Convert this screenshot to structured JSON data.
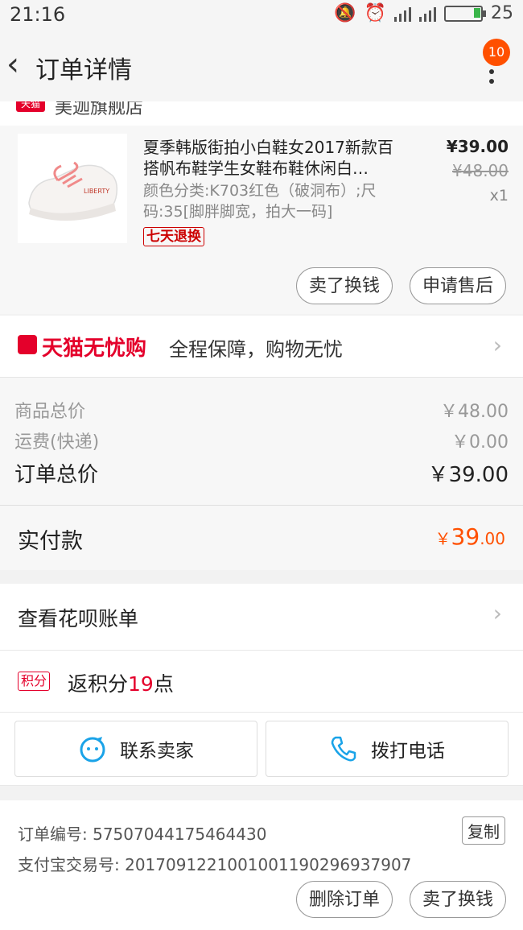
{
  "status": {
    "time": "21:16",
    "battery": "25"
  },
  "nav": {
    "title": "订单详情",
    "badge": "10"
  },
  "shop": {
    "tag": "天猫",
    "name": "美迦旗舰店"
  },
  "product": {
    "title": "夏季韩版街拍小白鞋女2017新款百搭帆布鞋学生女鞋布鞋休闲白…",
    "spec": "颜色分类:K703红色（破洞布）;尺码:35[脚胖脚宽，拍大一码]",
    "tag": "七天退换",
    "price": "¥39.00",
    "original_price": "¥48.00",
    "quantity": "x1",
    "buttons": [
      "卖了换钱",
      "申请售后"
    ]
  },
  "tmall": {
    "brand": "天猫无忧购",
    "desc": "全程保障，购物无忧"
  },
  "summary": {
    "goods_label": "商品总价",
    "goods_value": "￥48.00",
    "shipping_label": "运费(快递)",
    "shipping_value": "￥0.00",
    "total_label": "订单总价",
    "total_value": "￥39.00"
  },
  "paid": {
    "label": "实付款",
    "currency": "￥",
    "int": "39",
    "dec": ".00"
  },
  "huabei": {
    "label": "查看花呗账单"
  },
  "points": {
    "badge": "积分",
    "prefix": "返积分",
    "value": "19",
    "suffix": "点"
  },
  "contact": {
    "seller": "联系卖家",
    "phone": "拨打电话"
  },
  "order": {
    "number_label": "订单编号:",
    "number": "57507044175464430",
    "copy": "复制",
    "alipay_label": "支付宝交易号:",
    "alipay": "2017091221001001190296937907",
    "buttons": [
      "删除订单",
      "卖了换钱"
    ]
  },
  "colors": {
    "accent": "#ff5000",
    "tmall_red": "#e4002b"
  }
}
